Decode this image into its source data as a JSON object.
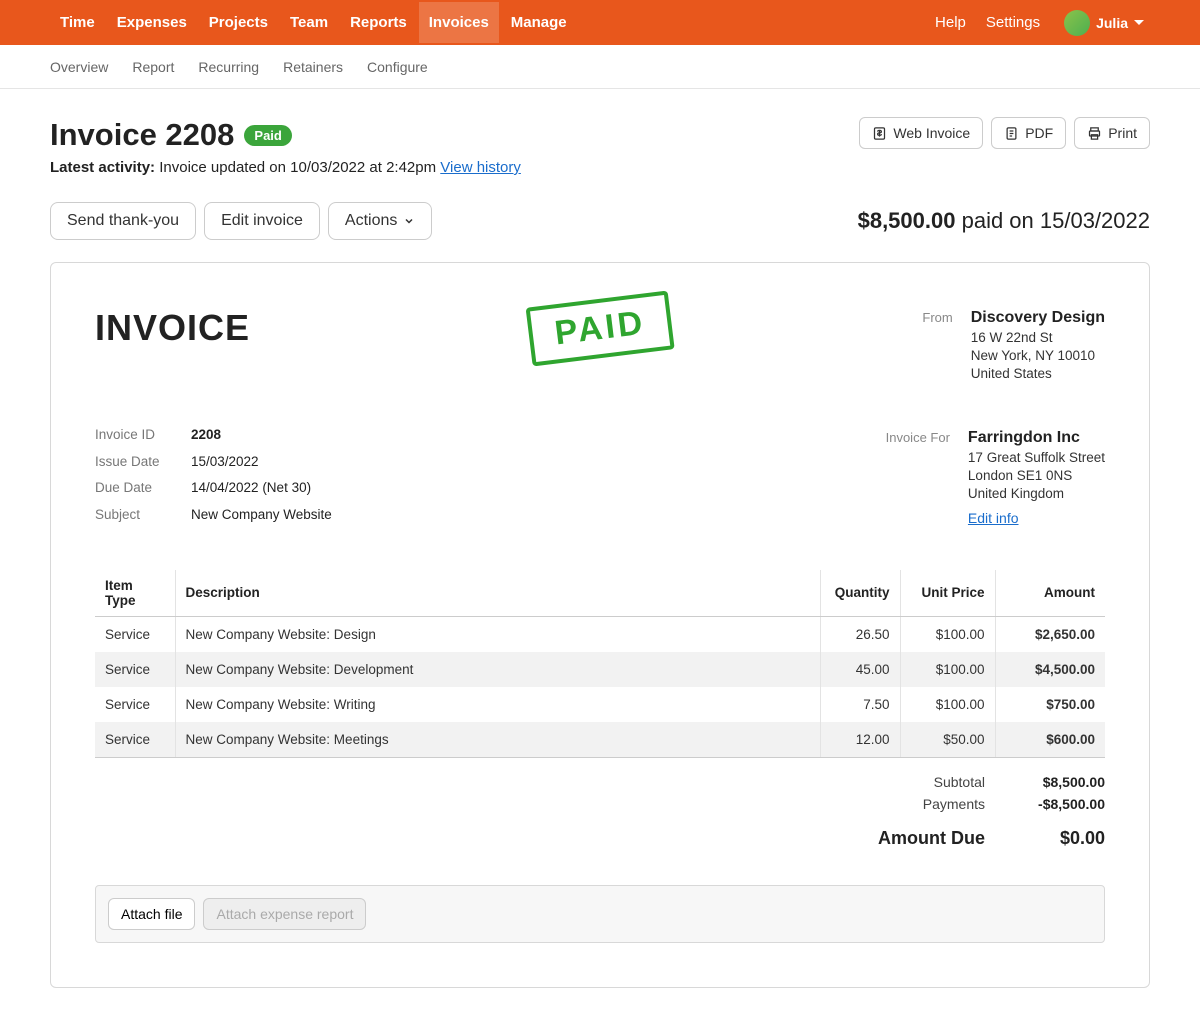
{
  "topnav": {
    "left": [
      "Time",
      "Expenses",
      "Projects",
      "Team",
      "Reports",
      "Invoices",
      "Manage"
    ],
    "active": "Invoices",
    "right": [
      "Help",
      "Settings"
    ],
    "user": "Julia"
  },
  "subnav": [
    "Overview",
    "Report",
    "Recurring",
    "Retainers",
    "Configure"
  ],
  "header": {
    "title": "Invoice 2208",
    "badge": "Paid",
    "activity_label": "Latest activity:",
    "activity_text": "Invoice updated on 10/03/2022 at 2:42pm",
    "view_history": "View history"
  },
  "export_buttons": {
    "web_invoice": "Web Invoice",
    "pdf": "PDF",
    "print": "Print"
  },
  "action_buttons": {
    "send_thank_you": "Send thank-you",
    "edit_invoice": "Edit invoice",
    "actions": "Actions"
  },
  "paid_summary": {
    "amount": "$8,500.00",
    "text": "paid on 15/03/2022"
  },
  "invoice": {
    "heading": "INVOICE",
    "stamp": "PAID",
    "from_label": "From",
    "from": {
      "name": "Discovery Design",
      "line1": "16 W 22nd St",
      "line2": "New York, NY 10010",
      "line3": "United States"
    },
    "for_label": "Invoice For",
    "for": {
      "name": "Farringdon Inc",
      "line1": "17 Great Suffolk Street",
      "line2": "London SE1 0NS",
      "line3": "United Kingdom"
    },
    "edit_info": "Edit info",
    "meta": {
      "id_label": "Invoice ID",
      "id": "2208",
      "issue_label": "Issue Date",
      "issue": "15/03/2022",
      "due_label": "Due Date",
      "due": "14/04/2022 (Net 30)",
      "subject_label": "Subject",
      "subject": "New Company Website"
    },
    "columns": {
      "type": "Item Type",
      "desc": "Description",
      "qty": "Quantity",
      "price": "Unit Price",
      "amount": "Amount"
    },
    "items": [
      {
        "type": "Service",
        "desc": "New Company Website: Design",
        "qty": "26.50",
        "price": "$100.00",
        "amount": "$2,650.00"
      },
      {
        "type": "Service",
        "desc": "New Company Website: Development",
        "qty": "45.00",
        "price": "$100.00",
        "amount": "$4,500.00"
      },
      {
        "type": "Service",
        "desc": "New Company Website: Writing",
        "qty": "7.50",
        "price": "$100.00",
        "amount": "$750.00"
      },
      {
        "type": "Service",
        "desc": "New Company Website: Meetings",
        "qty": "12.00",
        "price": "$50.00",
        "amount": "$600.00"
      }
    ],
    "totals": {
      "subtotal_label": "Subtotal",
      "subtotal": "$8,500.00",
      "payments_label": "Payments",
      "payments": "-$8,500.00",
      "due_label": "Amount Due",
      "due": "$0.00"
    },
    "attach": {
      "file": "Attach file",
      "expense": "Attach expense report"
    }
  }
}
